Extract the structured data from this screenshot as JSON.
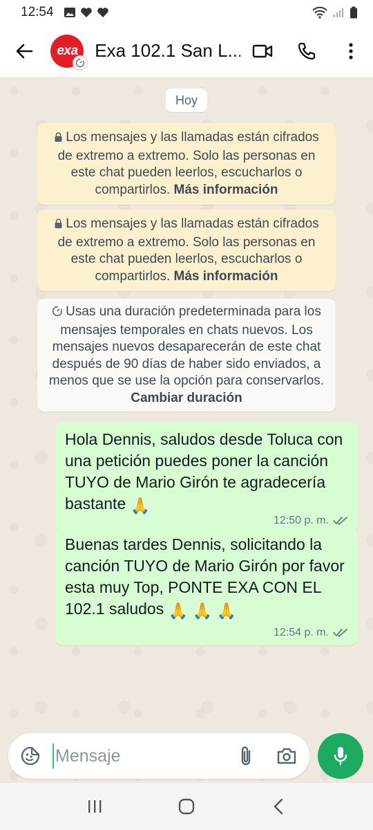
{
  "status_bar": {
    "time": "12:54"
  },
  "header": {
    "title": "Exa 102.1 San L...",
    "avatar_text": "exa"
  },
  "chat": {
    "date_chip": "Hoy",
    "system_messages": [
      {
        "text": "Los mensajes y las llamadas están cifrados de extremo a extremo. Solo las personas en este chat pueden leerlos, escucharlos o compartirlos.",
        "link": "Más información"
      },
      {
        "text": "Los mensajes y las llamadas están cifrados de extremo a extremo. Solo las personas en este chat pueden leerlos, escucharlos o compartirlos.",
        "link": "Más información"
      },
      {
        "text": "Usas una duración predeterminada para los mensajes temporales en chats nuevos. Los mensajes nuevos desaparecerán de este chat después de 90 días de haber sido enviados, a menos que se use la opción para conservarlos.",
        "link": "Cambiar duración"
      }
    ],
    "messages": [
      {
        "text": "Hola Dennis, saludos desde Toluca con una petición puedes poner la canción TUYO de Mario Girón te agradecería bastante",
        "emoji": "🙏",
        "time": "12:50 p. m."
      },
      {
        "text": "Buenas tardes Dennis, solicitando la canción TUYO de Mario Girón por favor esta muy Top, PONTE EXA CON EL 102.1 saludos",
        "emoji": "🙏 🙏 🙏",
        "time": "12:54 p. m."
      }
    ]
  },
  "composer": {
    "placeholder": "Mensaje"
  },
  "colors": {
    "accent": "#1daa61",
    "bubble_out": "#d9fdd3",
    "encryption_notice": "#fdf0cf",
    "read_ticks": "#667781",
    "avatar_brand": "#e41e26"
  },
  "icons": [
    "back-arrow-icon",
    "video-call-icon",
    "phone-icon",
    "more-vert-icon",
    "lock-icon",
    "timer-icon",
    "double-check-icon",
    "sticker-icon",
    "attach-icon",
    "camera-icon",
    "mic-icon",
    "recent-apps-icon",
    "home-icon",
    "back-nav-icon"
  ]
}
